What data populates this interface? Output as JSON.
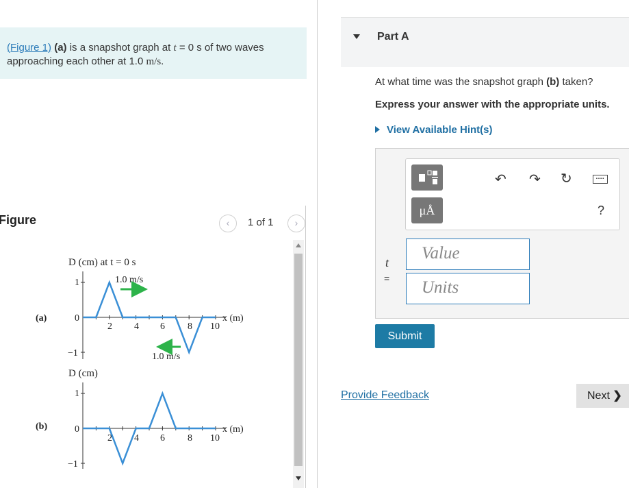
{
  "problem": {
    "figure_link": "(Figure 1)",
    "label_a": "(a)",
    "text_1": " is a snapshot graph at ",
    "t_var": "t",
    "text_2": " = 0 s of two waves approaching each other at 1.0 ",
    "unit": "m/s",
    "text_3": "."
  },
  "figure": {
    "heading": "Figure",
    "pager": "1 of 1",
    "prev_icon": "chevron-left-icon",
    "next_icon": "chevron-right-icon",
    "graph_a": {
      "label": "(a)",
      "ylabel": "D (cm) at t = 0 s",
      "xlabel": "x (m)",
      "y_ticks": [
        "1",
        "0",
        "−1"
      ],
      "x_ticks": [
        "2",
        "4",
        "6",
        "8",
        "10"
      ],
      "speed_right": "1.0 m/s",
      "speed_left": "1.0 m/s",
      "wave_points": [
        [
          0,
          0
        ],
        [
          1,
          0
        ],
        [
          2,
          1
        ],
        [
          3,
          0
        ],
        [
          6,
          0
        ],
        [
          7,
          0
        ],
        [
          8,
          -1
        ],
        [
          9,
          0
        ],
        [
          10,
          0
        ]
      ]
    },
    "graph_b": {
      "label": "(b)",
      "ylabel": "D (cm)",
      "xlabel": "x (m)",
      "y_ticks": [
        "1",
        "0",
        "−1"
      ],
      "x_ticks": [
        "2",
        "4",
        "6",
        "8",
        "10"
      ],
      "wave_points": [
        [
          0,
          0
        ],
        [
          2,
          0
        ],
        [
          3,
          -1
        ],
        [
          4,
          0
        ],
        [
          5,
          0
        ],
        [
          6,
          1
        ],
        [
          7,
          0
        ],
        [
          10,
          0
        ]
      ]
    },
    "arrow_color": "#2db34a",
    "wave_color": "#3a8fd6"
  },
  "part": {
    "title": "Part A",
    "question_1": "At what time was the snapshot graph ",
    "question_b": "(b)",
    "question_2": " taken?",
    "instruction": "Express your answer with the appropriate units.",
    "hints": "View Available Hint(s)"
  },
  "answer": {
    "variable": "t",
    "equals": "=",
    "value_placeholder": "Value",
    "units_placeholder": "Units",
    "units_button": "μÅ",
    "help": "?",
    "toolbar_icons": [
      "templates-icon",
      "undo-icon",
      "redo-icon",
      "reset-icon",
      "keyboard-icon",
      "help-icon"
    ]
  },
  "submit_label": "Submit",
  "feedback_label": "Provide Feedback",
  "next_label": "Next"
}
